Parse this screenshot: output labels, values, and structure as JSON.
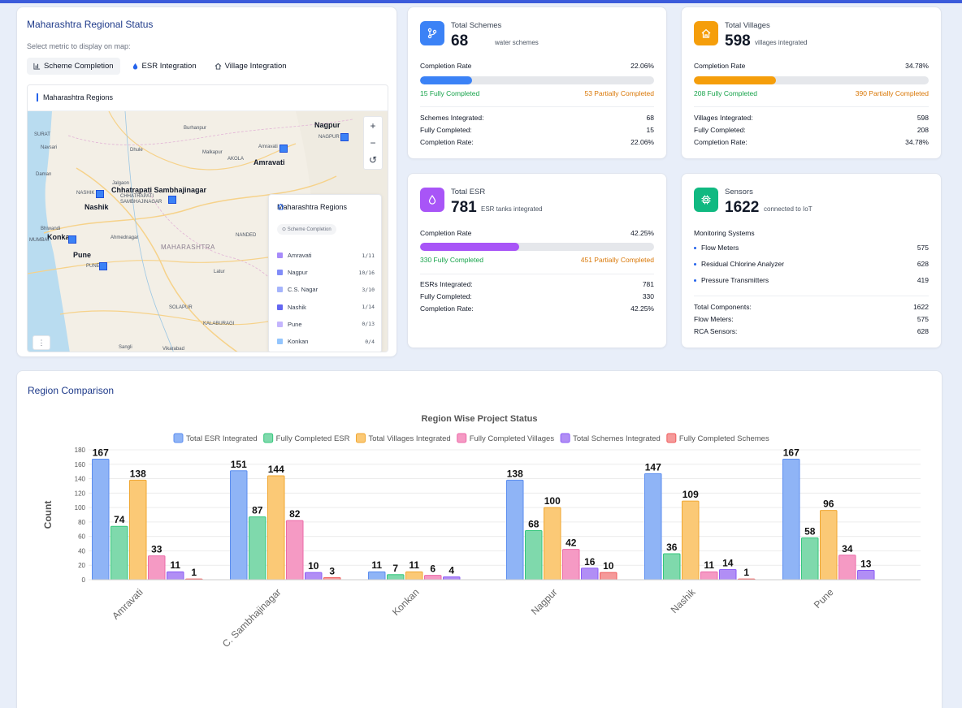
{
  "map_panel": {
    "title": "Maharashtra Regional Status",
    "select_label": "Select metric to display on map:",
    "tabs": [
      {
        "label": "Scheme Completion",
        "icon": "bar-chart-icon"
      },
      {
        "label": "ESR Integration",
        "icon": "droplet-icon"
      },
      {
        "label": "Village Integration",
        "icon": "home-icon"
      }
    ],
    "map_header": "Maharashtra Regions",
    "zoom_in": "+",
    "zoom_out": "−",
    "reset": "↺",
    "locate": "⋮",
    "cities_small": [
      "SURAT",
      "Navsari",
      "Daman",
      "Bhiwandi",
      "MUMBAI",
      "Dhule",
      "Burhanpur",
      "Malkapur",
      "AKOLA",
      "Amravati",
      "NAGPUR",
      "Jalgaon",
      "Ahmednagar",
      "NANDED",
      "Latur",
      "SOLAPUR",
      "KALABURAGI",
      "Sangli",
      "Vikarabad",
      "NASHIK",
      "PUNE",
      "CHHATRAPATI SAMBHAJINAGAR"
    ],
    "cities_big": [
      "Nagpur",
      "Amravati",
      "Chhatrapati Sambhajinagar",
      "Nashik",
      "Konkan",
      "Pune"
    ],
    "state_label": "MAHARASHTRA",
    "legend": {
      "title": "Maharashtra Regions",
      "badge": "Scheme Completion",
      "rows": [
        {
          "name": "Amravati",
          "count": "1/11",
          "color": "#a78bfa"
        },
        {
          "name": "Nagpur",
          "count": "10/16",
          "color": "#818cf8"
        },
        {
          "name": "C.S. Nagar",
          "count": "3/10",
          "color": "#a5b4fc"
        },
        {
          "name": "Nashik",
          "count": "1/14",
          "color": "#6366f1"
        },
        {
          "name": "Pune",
          "count": "0/13",
          "color": "#c4b5fd"
        },
        {
          "name": "Konkan",
          "count": "0/4",
          "color": "#93c5fd"
        }
      ]
    }
  },
  "cards": {
    "schemes": {
      "title": "Total Schemes",
      "value": "68",
      "subtitle": "water schemes",
      "icon": "git-branch-icon",
      "color": "#3b82f6",
      "rate_label": "Completion Rate",
      "rate_value": "22.06%",
      "progress": 0.2206,
      "full_label": "15 Fully Completed",
      "partial_label": "53 Partially Completed",
      "details": [
        {
          "label": "Schemes Integrated:",
          "value": "68"
        },
        {
          "label": "Fully Completed:",
          "value": "15"
        },
        {
          "label": "Completion Rate:",
          "value": "22.06%"
        }
      ]
    },
    "villages": {
      "title": "Total Villages",
      "value": "598",
      "subtitle": "villages integrated",
      "icon": "home-icon",
      "color": "#f59e0b",
      "rate_label": "Completion Rate",
      "rate_value": "34.78%",
      "progress": 0.3478,
      "full_label": "208 Fully Completed",
      "partial_label": "390 Partially Completed",
      "details": [
        {
          "label": "Villages Integrated:",
          "value": "598"
        },
        {
          "label": "Fully Completed:",
          "value": "208"
        },
        {
          "label": "Completion Rate:",
          "value": "34.78%"
        }
      ]
    },
    "esr": {
      "title": "Total ESR",
      "value": "781",
      "subtitle": "ESR tanks integrated",
      "icon": "droplet-icon",
      "color": "#a855f7",
      "rate_label": "Completion Rate",
      "rate_value": "42.25%",
      "progress": 0.4225,
      "full_label": "330 Fully Completed",
      "partial_label": "451 Partially Completed",
      "details": [
        {
          "label": "ESRs Integrated:",
          "value": "781"
        },
        {
          "label": "Fully Completed:",
          "value": "330"
        },
        {
          "label": "Completion Rate:",
          "value": "42.25%"
        }
      ]
    },
    "sensors": {
      "title": "Sensors",
      "value": "1622",
      "subtitle": "connected to IoT",
      "icon": "cpu-icon",
      "color": "#10b981",
      "section_label": "Monitoring Systems",
      "systems": [
        {
          "label": "Flow Meters",
          "value": "575"
        },
        {
          "label": "Residual Chlorine Analyzer",
          "value": "628"
        },
        {
          "label": "Pressure Transmitters",
          "value": "419"
        }
      ],
      "details": [
        {
          "label": "Total Components:",
          "value": "1622"
        },
        {
          "label": "Flow Meters:",
          "value": "575"
        },
        {
          "label": "RCA Sensors:",
          "value": "628"
        }
      ]
    }
  },
  "comparison": {
    "title": "Region Comparison"
  },
  "chart_data": {
    "type": "bar",
    "title": "Region Wise Project Status",
    "ylabel": "Count",
    "xlabel": "",
    "ylim": [
      0,
      180
    ],
    "yticks": [
      0,
      20,
      40,
      60,
      80,
      100,
      120,
      140,
      160,
      180
    ],
    "grid": true,
    "legend_position": "top",
    "categories": [
      "Amravati",
      "C. Sambhajinagar",
      "Konkan",
      "Nagpur",
      "Nashik",
      "Pune"
    ],
    "series": [
      {
        "name": "Total ESR Integrated",
        "values": [
          167,
          151,
          11,
          138,
          147,
          167
        ],
        "fill": "#8fb4f6",
        "stroke": "#5b8def"
      },
      {
        "name": "Fully Completed ESR",
        "values": [
          74,
          87,
          7,
          68,
          36,
          58
        ],
        "fill": "#7fd9ac",
        "stroke": "#34c77b"
      },
      {
        "name": "Total Villages Integrated",
        "values": [
          138,
          144,
          11,
          100,
          109,
          96
        ],
        "fill": "#fbc976",
        "stroke": "#f0a732"
      },
      {
        "name": "Fully Completed Villages",
        "values": [
          33,
          82,
          6,
          42,
          11,
          34
        ],
        "fill": "#f59ac4",
        "stroke": "#ec6aa8"
      },
      {
        "name": "Total Schemes Integrated",
        "values": [
          11,
          10,
          4,
          16,
          14,
          13
        ],
        "fill": "#b18ef5",
        "stroke": "#8b5cf6"
      },
      {
        "name": "Fully Completed Schemes",
        "values": [
          1,
          3,
          0,
          10,
          1,
          0
        ],
        "fill": "#f59a9a",
        "stroke": "#ef5b5b"
      }
    ],
    "data_labels_shown": [
      [
        true,
        true,
        true,
        true,
        true,
        true
      ],
      [
        true,
        true,
        true,
        true,
        true,
        true
      ],
      [
        true,
        true,
        true,
        true,
        true,
        false
      ],
      [
        true,
        true,
        true,
        true,
        true,
        true
      ],
      [
        true,
        true,
        true,
        true,
        true,
        true
      ],
      [
        true,
        true,
        true,
        true,
        true,
        false
      ]
    ]
  }
}
